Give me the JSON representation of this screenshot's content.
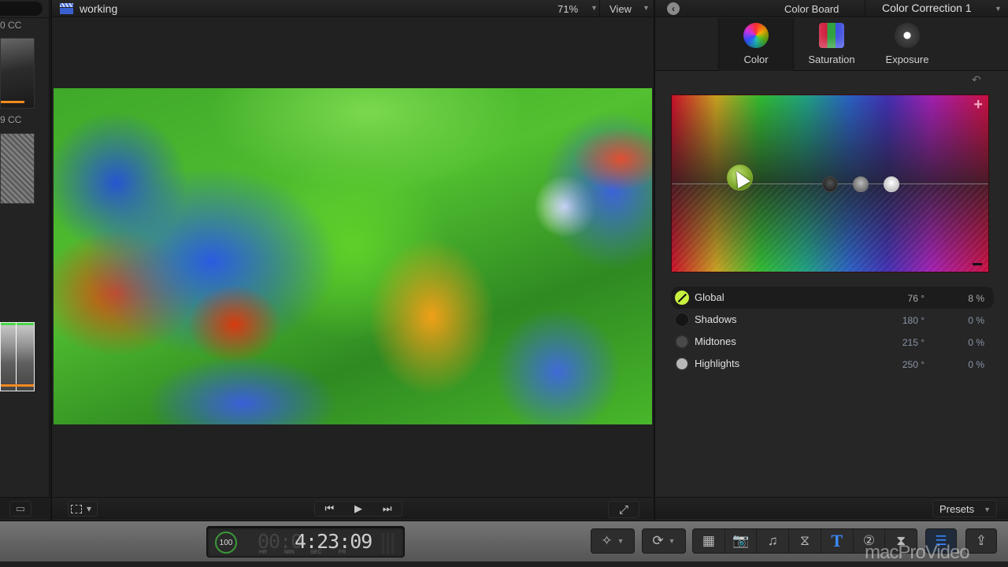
{
  "browser": {
    "clips": [
      {
        "label": "0 CC"
      },
      {
        "label": "9 CC"
      }
    ],
    "filmstrip_icon": "filmstrip-icon"
  },
  "viewer": {
    "title": "working",
    "zoom": "71%",
    "view_label": "View",
    "caret": "▼",
    "transform_icon": "▾",
    "transport": {
      "prev": "⏮",
      "play": "▶",
      "next": "⏭"
    },
    "fullscreen_icon": "⤢"
  },
  "inspector": {
    "back_icon": "‹",
    "title": "Color Board",
    "correction": "Color Correction 1",
    "caret": "▼",
    "tabs": [
      {
        "label": "Color",
        "active": true
      },
      {
        "label": "Saturation",
        "active": false
      },
      {
        "label": "Exposure",
        "active": false
      }
    ],
    "reset_icon": "↶",
    "board": {
      "plus": "+"
    },
    "rows": [
      {
        "name": "Global",
        "angle": "76 °",
        "percent": "8 %"
      },
      {
        "name": "Shadows",
        "angle": "180 °",
        "percent": "0 %"
      },
      {
        "name": "Midtones",
        "angle": "215 °",
        "percent": "0 %"
      },
      {
        "name": "Highlights",
        "angle": "250 °",
        "percent": "0 %"
      }
    ],
    "presets_label": "Presets"
  },
  "toolbar": {
    "timecode": {
      "speed": "100",
      "dim_prefix": "00:0",
      "value": "4:23:09",
      "units": [
        "HR",
        "MIN",
        "SEC",
        "FR"
      ]
    },
    "enhance_icon": "✧",
    "retime_icon": "⟳",
    "buttons": [
      {
        "name": "photo-video-browser",
        "icon": "▦"
      },
      {
        "name": "photos",
        "icon": "📷"
      },
      {
        "name": "music",
        "icon": "♫"
      },
      {
        "name": "transitions",
        "icon": "⧖"
      },
      {
        "name": "titles",
        "icon": "T"
      },
      {
        "name": "generators",
        "icon": "②"
      },
      {
        "name": "themes",
        "icon": "⧗"
      }
    ],
    "inspector_icon": "☰",
    "share_icon": "⇪",
    "watermark": "macProVideo"
  }
}
